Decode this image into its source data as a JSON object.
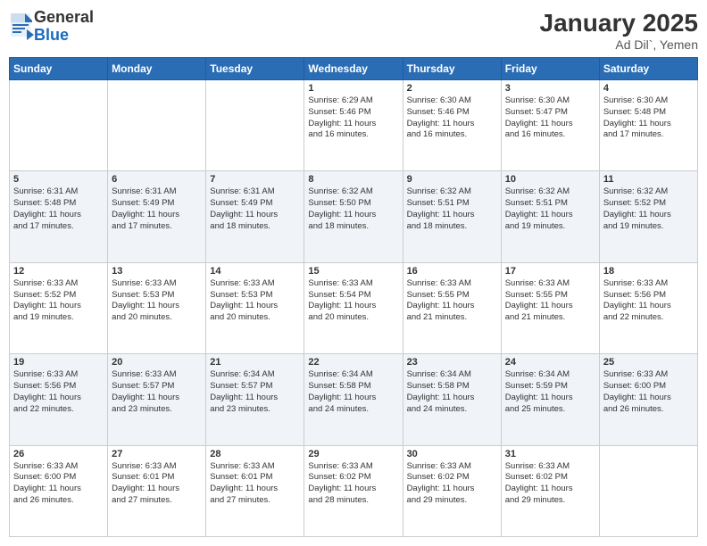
{
  "header": {
    "logo": {
      "line1": "General",
      "line2": "Blue"
    },
    "title": "January 2025",
    "subtitle": "Ad Dil`, Yemen"
  },
  "weekdays": [
    "Sunday",
    "Monday",
    "Tuesday",
    "Wednesday",
    "Thursday",
    "Friday",
    "Saturday"
  ],
  "weeks": [
    [
      {
        "day": "",
        "info": ""
      },
      {
        "day": "",
        "info": ""
      },
      {
        "day": "",
        "info": ""
      },
      {
        "day": "1",
        "info": "Sunrise: 6:29 AM\nSunset: 5:46 PM\nDaylight: 11 hours\nand 16 minutes."
      },
      {
        "day": "2",
        "info": "Sunrise: 6:30 AM\nSunset: 5:46 PM\nDaylight: 11 hours\nand 16 minutes."
      },
      {
        "day": "3",
        "info": "Sunrise: 6:30 AM\nSunset: 5:47 PM\nDaylight: 11 hours\nand 16 minutes."
      },
      {
        "day": "4",
        "info": "Sunrise: 6:30 AM\nSunset: 5:48 PM\nDaylight: 11 hours\nand 17 minutes."
      }
    ],
    [
      {
        "day": "5",
        "info": "Sunrise: 6:31 AM\nSunset: 5:48 PM\nDaylight: 11 hours\nand 17 minutes."
      },
      {
        "day": "6",
        "info": "Sunrise: 6:31 AM\nSunset: 5:49 PM\nDaylight: 11 hours\nand 17 minutes."
      },
      {
        "day": "7",
        "info": "Sunrise: 6:31 AM\nSunset: 5:49 PM\nDaylight: 11 hours\nand 18 minutes."
      },
      {
        "day": "8",
        "info": "Sunrise: 6:32 AM\nSunset: 5:50 PM\nDaylight: 11 hours\nand 18 minutes."
      },
      {
        "day": "9",
        "info": "Sunrise: 6:32 AM\nSunset: 5:51 PM\nDaylight: 11 hours\nand 18 minutes."
      },
      {
        "day": "10",
        "info": "Sunrise: 6:32 AM\nSunset: 5:51 PM\nDaylight: 11 hours\nand 19 minutes."
      },
      {
        "day": "11",
        "info": "Sunrise: 6:32 AM\nSunset: 5:52 PM\nDaylight: 11 hours\nand 19 minutes."
      }
    ],
    [
      {
        "day": "12",
        "info": "Sunrise: 6:33 AM\nSunset: 5:52 PM\nDaylight: 11 hours\nand 19 minutes."
      },
      {
        "day": "13",
        "info": "Sunrise: 6:33 AM\nSunset: 5:53 PM\nDaylight: 11 hours\nand 20 minutes."
      },
      {
        "day": "14",
        "info": "Sunrise: 6:33 AM\nSunset: 5:53 PM\nDaylight: 11 hours\nand 20 minutes."
      },
      {
        "day": "15",
        "info": "Sunrise: 6:33 AM\nSunset: 5:54 PM\nDaylight: 11 hours\nand 20 minutes."
      },
      {
        "day": "16",
        "info": "Sunrise: 6:33 AM\nSunset: 5:55 PM\nDaylight: 11 hours\nand 21 minutes."
      },
      {
        "day": "17",
        "info": "Sunrise: 6:33 AM\nSunset: 5:55 PM\nDaylight: 11 hours\nand 21 minutes."
      },
      {
        "day": "18",
        "info": "Sunrise: 6:33 AM\nSunset: 5:56 PM\nDaylight: 11 hours\nand 22 minutes."
      }
    ],
    [
      {
        "day": "19",
        "info": "Sunrise: 6:33 AM\nSunset: 5:56 PM\nDaylight: 11 hours\nand 22 minutes."
      },
      {
        "day": "20",
        "info": "Sunrise: 6:33 AM\nSunset: 5:57 PM\nDaylight: 11 hours\nand 23 minutes."
      },
      {
        "day": "21",
        "info": "Sunrise: 6:34 AM\nSunset: 5:57 PM\nDaylight: 11 hours\nand 23 minutes."
      },
      {
        "day": "22",
        "info": "Sunrise: 6:34 AM\nSunset: 5:58 PM\nDaylight: 11 hours\nand 24 minutes."
      },
      {
        "day": "23",
        "info": "Sunrise: 6:34 AM\nSunset: 5:58 PM\nDaylight: 11 hours\nand 24 minutes."
      },
      {
        "day": "24",
        "info": "Sunrise: 6:34 AM\nSunset: 5:59 PM\nDaylight: 11 hours\nand 25 minutes."
      },
      {
        "day": "25",
        "info": "Sunrise: 6:33 AM\nSunset: 6:00 PM\nDaylight: 11 hours\nand 26 minutes."
      }
    ],
    [
      {
        "day": "26",
        "info": "Sunrise: 6:33 AM\nSunset: 6:00 PM\nDaylight: 11 hours\nand 26 minutes."
      },
      {
        "day": "27",
        "info": "Sunrise: 6:33 AM\nSunset: 6:01 PM\nDaylight: 11 hours\nand 27 minutes."
      },
      {
        "day": "28",
        "info": "Sunrise: 6:33 AM\nSunset: 6:01 PM\nDaylight: 11 hours\nand 27 minutes."
      },
      {
        "day": "29",
        "info": "Sunrise: 6:33 AM\nSunset: 6:02 PM\nDaylight: 11 hours\nand 28 minutes."
      },
      {
        "day": "30",
        "info": "Sunrise: 6:33 AM\nSunset: 6:02 PM\nDaylight: 11 hours\nand 29 minutes."
      },
      {
        "day": "31",
        "info": "Sunrise: 6:33 AM\nSunset: 6:02 PM\nDaylight: 11 hours\nand 29 minutes."
      },
      {
        "day": "",
        "info": ""
      }
    ]
  ]
}
